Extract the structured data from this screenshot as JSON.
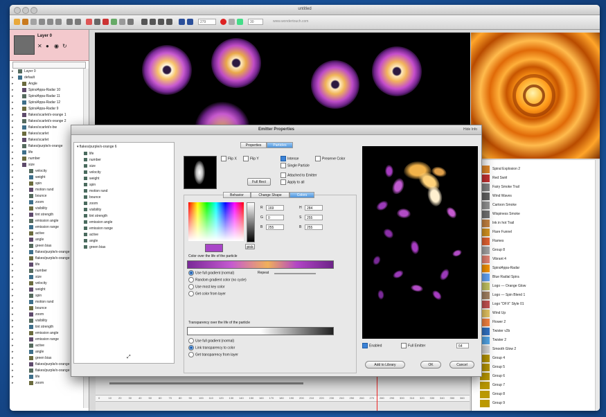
{
  "window": {
    "title": "untitled",
    "url": "www.wondertouch.com",
    "frame_field": "279",
    "fps_field": "30"
  },
  "colors": {
    "layer_bg": "#f3c9cd",
    "selection": "#4d94dc",
    "accent_red": "#e22222"
  },
  "layer": {
    "name": "Layer 0"
  },
  "left_tree": {
    "search_placeholder": "",
    "items": [
      "Layer 0",
      "default",
      "Angle",
      "Spiral4ppa-Radar 10",
      "Spiral4ppa-Radar 11",
      "Spiral4ppa-Radar 12",
      "Spiral4ppa-Radar 9",
      "flakes/scarlet/x-orange 1",
      "flakes/scarlet/x-orange 2",
      "flakes/scarlet/x-bw",
      "flakes/scarlet",
      "flakes/scarlet",
      "flakes/purple/x-orange",
      "life",
      "number",
      "size",
      "velocity",
      "weight",
      "spin",
      "motion rand",
      "bounce",
      "zoom",
      "visibility",
      "tint strength",
      "emission angle",
      "emission range",
      "active",
      "angle",
      "green bias",
      "flakes/purple/x-orange 1",
      "flakes/purple/x-orange 2",
      "life",
      "number",
      "size",
      "velocity",
      "weight",
      "spin",
      "motion rand",
      "bounce",
      "zoom",
      "visibility",
      "tint strength",
      "emission angle",
      "emission range",
      "active",
      "angle",
      "green bias",
      "flakes/purple/x-orange 1",
      "flakes/purple/x-orange 2",
      "life",
      "zoom"
    ]
  },
  "dialog": {
    "title": "Emitter Properties",
    "close_label": "Hide Info",
    "tabs": [
      "Properties",
      "Particles"
    ],
    "tree_root": "flakes/purple/x-orange 6",
    "tree_items": [
      "life",
      "number",
      "size",
      "velocity",
      "weight",
      "spin",
      "motion rand",
      "bounce",
      "zoom",
      "visibility",
      "tint strength",
      "emission angle",
      "emission range",
      "active",
      "angle",
      "green bias"
    ],
    "checkboxes": {
      "flip_x": "Flip X",
      "flip_y": "Flip Y",
      "intense": "Intense",
      "preserve_color": "Preserve Color",
      "single_particle": "Single Particle",
      "attached": "Attached to Emitter",
      "apply_all": "Apply to all"
    },
    "full_rect_button": "Full Rect",
    "sub_tabs": [
      "Behavior",
      "Change Shape",
      "Colors"
    ],
    "rgb": {
      "r": "169",
      "g": "0",
      "b": "255"
    },
    "hsb": {
      "h": "284",
      "s": "255",
      "b": "255"
    },
    "rgb_labels": [
      "R",
      "G",
      "B"
    ],
    "hsb_labels": [
      "H",
      "S",
      "B"
    ],
    "pick_button": "pick",
    "color_section_title": "Color over the life of the particle",
    "repeat_label": "Repeat",
    "color_options": [
      "Use full gradient (normal)",
      "Random gradient color (no cycle)",
      "Use most key color",
      "Get color from layer"
    ],
    "transparency_title": "Transparency over the life of the particle",
    "transparency_options": [
      "Use full gradient (normal)",
      "Link transparency to color",
      "Get transparency from layer"
    ],
    "enabled_label": "Enabled",
    "full_emitter_label": "Full Emitter",
    "size_value": "64",
    "add_library_button": "Add to Library",
    "ok_button": "OK",
    "cancel_button": "Cancel"
  },
  "library": {
    "items": [
      "Spiral Explosion 2",
      "Red Swirl",
      "Fairy Smoke Trail",
      "Wind Waves",
      "Cartoon Smoke",
      "Wispiness Smoke",
      "Ink in hot Trail",
      "Flare Funnel",
      "Flames",
      "Group 8",
      "Vibrant 4",
      "Spiral4ppa-Radar",
      "Blue Radial Spira",
      "Logo — Orange Glow",
      "Logo — Spin Blend 1",
      "Logo \"DFX\" Style 01",
      "Wind Up",
      "Flower 2",
      "Twister v2b",
      "Twister 2",
      "Smooth Glow 2",
      "Group 4",
      "Group 5",
      "Group 6",
      "Group 7",
      "Group 8",
      "Group 9"
    ]
  },
  "timeline": {
    "ruler_labels": [
      "0",
      "10",
      "20",
      "30",
      "40",
      "50",
      "60",
      "70",
      "80",
      "90",
      "100",
      "110",
      "120",
      "130",
      "140",
      "150",
      "160",
      "170",
      "180",
      "190",
      "200",
      "210",
      "220",
      "230",
      "240",
      "250",
      "260",
      "270",
      "280",
      "290",
      "300",
      "310",
      "320",
      "330",
      "340",
      "350",
      "360"
    ]
  }
}
